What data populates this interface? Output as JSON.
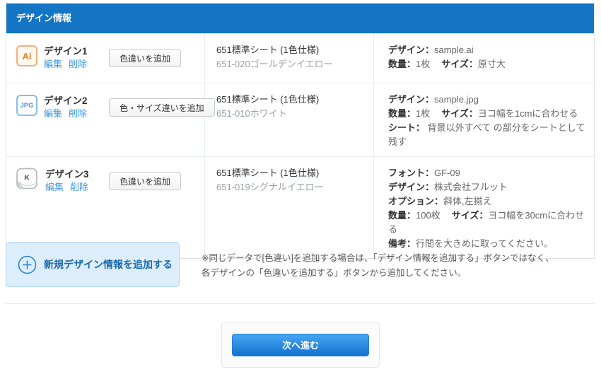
{
  "colors": {
    "header_bg": "#1375c4",
    "link_blue": "#3b97e3",
    "ai_icon_orange": "#e8831d",
    "jpg_icon_blue": "#3e93de",
    "add_box_bg": "#dcedfb",
    "add_box_border": "#b0d6f2",
    "add_label_blue": "#1c6ba8",
    "next_btn_gradient_top": "#47a6f1",
    "next_btn_gradient_bottom": "#1172d1"
  },
  "header": {
    "title": "デザイン情報"
  },
  "rows": [
    {
      "icon": "ai-file-icon",
      "icon_label": "Ai",
      "title": "デザイン1",
      "edit_label": "編集",
      "delete_label": "削除",
      "variation_button": "色違いを追加",
      "sheet_line1": "651標準シート (1色仕様)",
      "sheet_line2": "651-020ゴールデンイエロー",
      "details": [
        [
          {
            "label": "デザイン：",
            "value": "sample.ai"
          }
        ],
        [
          {
            "label": "数量：",
            "value": "1枚"
          },
          {
            "label": "サイズ：",
            "value": "原寸大"
          }
        ]
      ]
    },
    {
      "icon": "jpg-file-icon",
      "icon_label": "JPG",
      "title": "デザイン2",
      "edit_label": "編集",
      "delete_label": "削除",
      "variation_button": "色・サイズ違いを追加",
      "sheet_line1": "651標準シート (1色仕様)",
      "sheet_line2": "651-010ホワイト",
      "details": [
        [
          {
            "label": "デザイン：",
            "value": "sample.jpg"
          }
        ],
        [
          {
            "label": "数量：",
            "value": "1枚"
          },
          {
            "label": "サイズ：",
            "value": "ヨコ幅を1cmに合わせる"
          }
        ],
        [
          {
            "label": "シート：",
            "value": " 背景以外すべて の部分をシートとして残す"
          }
        ]
      ]
    },
    {
      "icon": "keyboard-key-icon",
      "icon_label": "K",
      "title": "デザイン3",
      "edit_label": "編集",
      "delete_label": "削除",
      "variation_button": "色違いを追加",
      "sheet_line1": "651標準シート (1色仕様)",
      "sheet_line2": "651-019シグナルイエロー",
      "details": [
        [
          {
            "label": "フォント：",
            "value": "GF-09"
          }
        ],
        [
          {
            "label": "デザイン：",
            "value": "株式会社フルット"
          }
        ],
        [
          {
            "label": "オプション：",
            "value": "斜体,左揃え"
          }
        ],
        [
          {
            "label": "数量：",
            "value": "100枚"
          },
          {
            "label": "サイズ：",
            "value": "ヨコ幅を30cmに合わせる"
          }
        ],
        [
          {
            "label": "備考：",
            "value": "行間を大きめに取ってください。"
          }
        ]
      ]
    }
  ],
  "add_section": {
    "icon": "plus-circle-icon",
    "button_label": "新規デザイン情報を追加する",
    "note_line1": "※同じデータで[色違い]を追加する場合は、「デザイン情報を追加する」ボタンではなく、",
    "note_line2": "各デザインの「色違いを追加する」ボタンから追加してください。"
  },
  "footer": {
    "next_button": "次へ進む"
  }
}
